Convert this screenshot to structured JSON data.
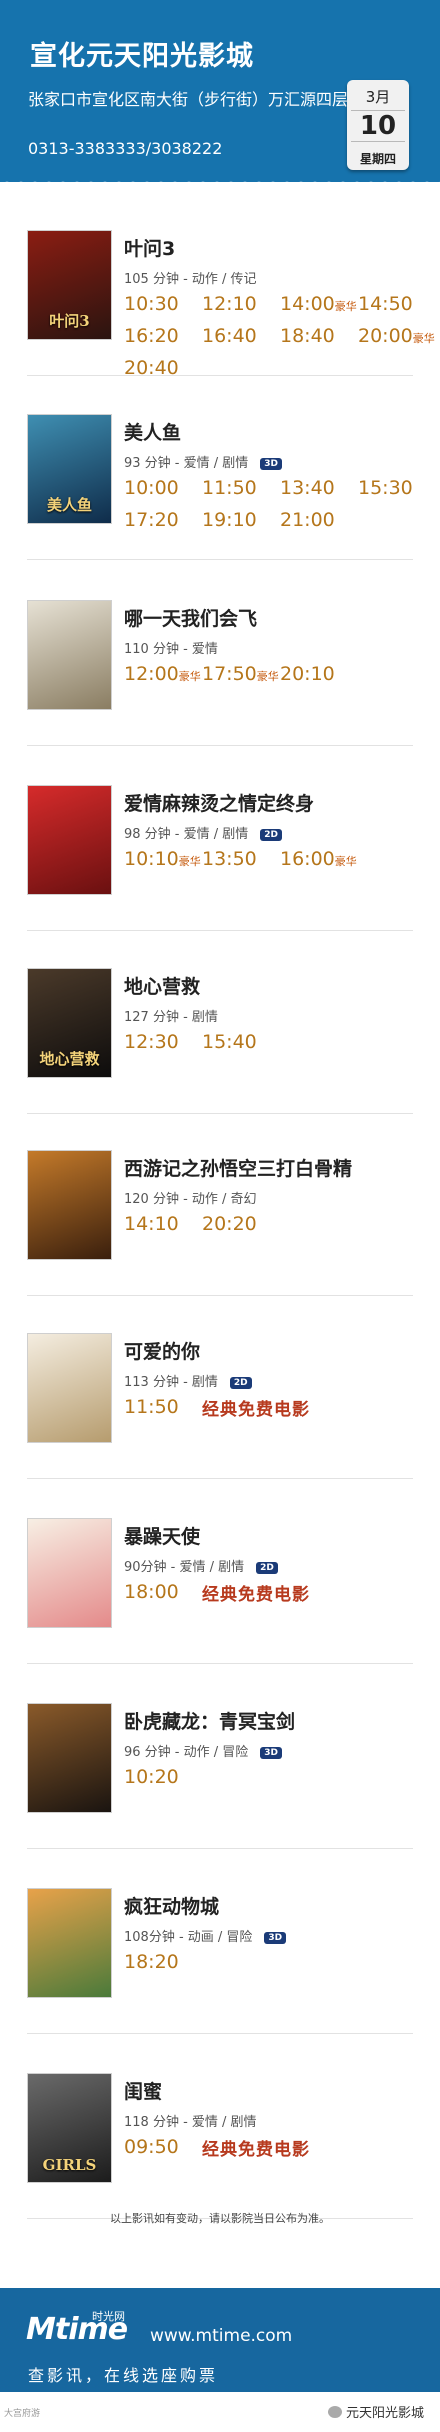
{
  "header": {
    "cinema_name": "宣化元天阳光影城",
    "address": "张家口市宣化区南大街（步行街）万汇源四层",
    "phone": "0313-3383333/3038222",
    "calendar": {
      "month": "3月",
      "day": "10",
      "weekday": "星期四"
    }
  },
  "movies": [
    {
      "title": "叶问3",
      "meta": "105 分钟 - 动作 / 传记",
      "badge": "",
      "rows": [
        [
          [
            "10:30",
            ""
          ],
          [
            "12:10",
            ""
          ],
          [
            "14:00",
            "豪华"
          ],
          [
            "14:50",
            ""
          ]
        ],
        [
          [
            "16:20",
            ""
          ],
          [
            "16:40",
            ""
          ],
          [
            "18:40",
            ""
          ],
          [
            "20:00",
            "豪华"
          ]
        ],
        [
          [
            "20:40",
            ""
          ]
        ]
      ],
      "poster_colors": [
        "#8b1d12",
        "#2a1410"
      ],
      "poster_text": "叶问3"
    },
    {
      "title": "美人鱼",
      "meta": "93 分钟 - 爱情 / 剧情",
      "badge": "3D",
      "rows": [
        [
          [
            "10:00",
            ""
          ],
          [
            "11:50",
            ""
          ],
          [
            "13:40",
            ""
          ],
          [
            "15:30",
            ""
          ]
        ],
        [
          [
            "17:20",
            ""
          ],
          [
            "19:10",
            ""
          ],
          [
            "21:00",
            ""
          ]
        ]
      ],
      "poster_colors": [
        "#3f8fb2",
        "#0f2c4a"
      ],
      "poster_text": "美人鱼"
    },
    {
      "title": "哪一天我们会飞",
      "meta": "110 分钟 - 爱情",
      "badge": "",
      "rows": [
        [
          [
            "12:00",
            "豪华"
          ],
          [
            "17:50",
            "豪华"
          ],
          [
            "20:10",
            ""
          ]
        ]
      ],
      "poster_colors": [
        "#e6e1d4",
        "#8a7d62"
      ],
      "poster_text": ""
    },
    {
      "title": "爱情麻辣烫之情定终身",
      "meta": "98 分钟 - 爱情 / 剧情",
      "badge": "2D",
      "rows": [
        [
          [
            "10:10",
            "豪华"
          ],
          [
            "13:50",
            ""
          ],
          [
            "16:00",
            "豪华"
          ]
        ]
      ],
      "poster_colors": [
        "#d62b2b",
        "#6a1010"
      ],
      "poster_text": ""
    },
    {
      "title": "地心营救",
      "meta": "127 分钟 - 剧情",
      "badge": "",
      "rows": [
        [
          [
            "12:30",
            ""
          ],
          [
            "15:40",
            ""
          ]
        ]
      ],
      "poster_colors": [
        "#4b3a2a",
        "#0d0c0c"
      ],
      "poster_text": "地心营救"
    },
    {
      "title": "西游记之孙悟空三打白骨精",
      "meta": "120 分钟 - 动作 / 奇幻",
      "badge": "",
      "rows": [
        [
          [
            "14:10",
            ""
          ],
          [
            "20:20",
            ""
          ]
        ]
      ],
      "poster_colors": [
        "#c47a2a",
        "#3a1f0d"
      ],
      "poster_text": ""
    },
    {
      "title": "可爱的你",
      "meta": "113 分钟 - 剧情",
      "badge": "2D",
      "rows": [
        [
          [
            "11:50",
            ""
          ]
        ]
      ],
      "free": "经典免费电影",
      "poster_colors": [
        "#f4ede0",
        "#b69c6e"
      ],
      "poster_text": ""
    },
    {
      "title": "暴躁天使",
      "meta": "90分钟 - 爱情 / 剧情",
      "badge": "2D",
      "rows": [
        [
          [
            "18:00",
            ""
          ]
        ]
      ],
      "free": "经典免费电影",
      "poster_colors": [
        "#f7efe4",
        "#e48a8a"
      ],
      "poster_text": ""
    },
    {
      "title": "卧虎藏龙：青冥宝剑",
      "meta": "96 分钟 - 动作 / 冒险",
      "badge": "3D",
      "rows": [
        [
          [
            "10:20",
            ""
          ]
        ]
      ],
      "poster_colors": [
        "#8a5a2a",
        "#1a1410"
      ],
      "poster_text": ""
    },
    {
      "title": "疯狂动物城",
      "meta": "108分钟 - 动画 / 冒险",
      "badge": "3D",
      "rows": [
        [
          [
            "18:20",
            ""
          ]
        ]
      ],
      "poster_colors": [
        "#e8a24a",
        "#4a7a3a"
      ],
      "poster_text": ""
    },
    {
      "title": "闺蜜",
      "meta": "118 分钟 - 爱情 / 剧情",
      "badge": "",
      "rows": [
        [
          [
            "09:50",
            ""
          ]
        ]
      ],
      "free": "经典免费电影",
      "poster_colors": [
        "#6a6a6a",
        "#1c1c1c"
      ],
      "poster_text": "GIRLS"
    }
  ],
  "notice": "以上影讯如有变动，请以影院当日公布为准。",
  "footer": {
    "logo": "Mtime",
    "logo_cn": "时光网",
    "site": "www.mtime.com",
    "slogan": "查影讯，在线选座购票",
    "watermark_left": "大宫府游",
    "watermark_right": "元天阳光影城"
  },
  "colors": {
    "header_bg": "#1673ad",
    "time": "#b5761b",
    "lux": "#c65b0e",
    "free": "#b73a1e"
  }
}
